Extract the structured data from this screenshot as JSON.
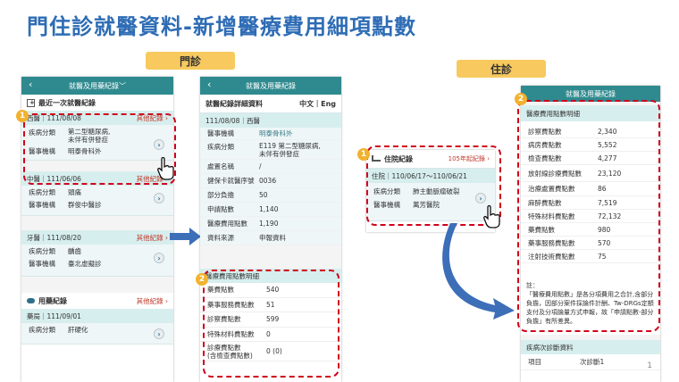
{
  "page_title": "門住診就醫資料-新增醫療費用細項點數",
  "tags": {
    "outpatient": "門診",
    "inpatient": "住診"
  },
  "badges": [
    "1",
    "2"
  ],
  "common": {
    "back_icon": "‹",
    "chev": "›"
  },
  "panel1": {
    "header": "就醫及用藥紀錄﹀",
    "section_title": "最近一次就醫紀錄",
    "cards": [
      {
        "head": "西醫｜111/08/08",
        "more": "其他紀錄 ›",
        "rows": [
          {
            "k": "疾病分類",
            "v": "第二型糖尿病,\n未伴有併發症"
          },
          {
            "k": "醫事機構",
            "v": "明泰骨科外"
          }
        ]
      },
      {
        "head": "中醫｜111/06/06",
        "more": "其他紀錄 ›",
        "rows": [
          {
            "k": "疾病分類",
            "v": "頭痛"
          },
          {
            "k": "醫事機構",
            "v": "群俊中醫診"
          }
        ]
      },
      {
        "head": "牙醫｜111/08/20",
        "more": "其他紀錄 ›",
        "rows": [
          {
            "k": "疾病分類",
            "v": "齲齒"
          },
          {
            "k": "醫事機構",
            "v": "臺北虛擬診"
          }
        ]
      }
    ],
    "med_section": "用藥紀錄",
    "med_more": "其他紀錄 ›",
    "med_card": {
      "head": "藥局｜111/09/01",
      "rows": [
        {
          "k": "疾病分類",
          "v": "肝硬化"
        }
      ]
    }
  },
  "panel2": {
    "header": "就醫及用藥紀錄",
    "subheader": "就醫紀錄詳細資料",
    "lang": "中文｜Eng",
    "visit": "111/08/08｜西醫",
    "rows": [
      {
        "k": "醫事機構",
        "v": "明泰骨科外"
      },
      {
        "k": "疾病分類",
        "v": "E119 第二型糖尿病,\n未伴有併發症"
      },
      {
        "k": "處置名稱",
        "v": "/"
      },
      {
        "k": "健保卡就醫序號",
        "v": "0036"
      },
      {
        "k": "部分負擔",
        "v": "50"
      },
      {
        "k": "申請點數",
        "v": "1,140"
      },
      {
        "k": "醫療費用點數",
        "v": "1,190"
      },
      {
        "k": "資料來源",
        "v": "申報資料"
      }
    ],
    "fee_title": "醫療費用點數明細",
    "fees": [
      {
        "k": "藥費點數",
        "v": "540"
      },
      {
        "k": "藥事服務費點數",
        "v": "51"
      },
      {
        "k": "診察費點數",
        "v": "599"
      },
      {
        "k": "特殊材料費點數",
        "v": "0"
      },
      {
        "k": "診療費點數\n(含檢查費點數)",
        "v": "0 (0)"
      }
    ]
  },
  "panel3": {
    "section": "住院紀錄",
    "more": "105年起紀錄 ›",
    "stay": "住院｜110/06/17～110/06/21",
    "rows": [
      {
        "k": "疾病分類",
        "v": "肺主動脈瘤破裂"
      },
      {
        "k": "醫事機構",
        "v": "萬芳醫院"
      }
    ]
  },
  "panel4": {
    "header": "就醫及用藥紀錄",
    "fee_title": "醫療費用點數明細",
    "fees": [
      {
        "k": "診察費點數",
        "v": "2,340"
      },
      {
        "k": "病房費點數",
        "v": "5,552"
      },
      {
        "k": "檢查費點數",
        "v": "4,277"
      },
      {
        "k": "放射線診療費點數",
        "v": "23,120"
      },
      {
        "k": "治療處置費點數",
        "v": "86"
      },
      {
        "k": "麻醉費點數",
        "v": "7,519"
      },
      {
        "k": "特殊材料費點數",
        "v": "72,132"
      },
      {
        "k": "藥費點數",
        "v": "980"
      },
      {
        "k": "藥事服務費點數",
        "v": "570"
      },
      {
        "k": "注射技術費點數",
        "v": "75"
      }
    ],
    "note": "註：\n「醫療費用點數」是各分項費用之合計,含部分負擔，因部分案件採論件計酬、Tw-DRGs定額支付及分項論量方式申報，故「申請點數-部分負擔」有所差異。",
    "diag_section": "疾病次診斷資料",
    "diag_row": {
      "k": "項目",
      "v": "次診斷1"
    }
  },
  "page_number": "1"
}
